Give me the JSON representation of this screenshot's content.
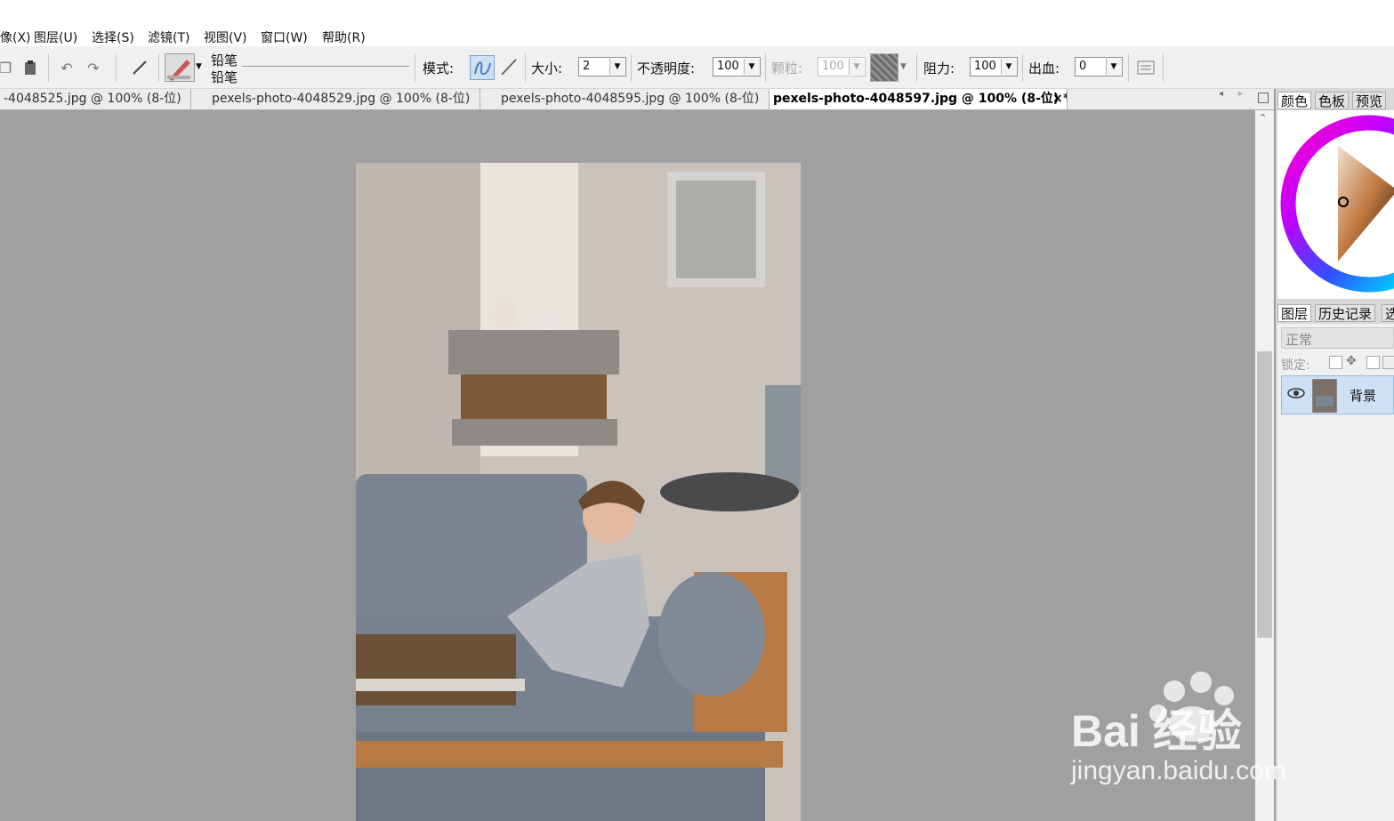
{
  "menu": [
    "像(X)",
    "图层(U)",
    "选择(S)",
    "滤镜(T)",
    "视图(V)",
    "窗口(W)",
    "帮助(R)"
  ],
  "toolbar": {
    "brush_name_top": "铅笔",
    "brush_name_bottom": "铅笔",
    "mode_label": "模式:",
    "size_label": "大小:",
    "size_value": "2",
    "opacity_label": "不透明度:",
    "opacity_value": "100",
    "grain_label": "颗粒:",
    "grain_value": "100",
    "resist_label": "阻力:",
    "resist_value": "100",
    "bleed_label": "出血:",
    "bleed_value": "0"
  },
  "tabs": [
    {
      "label": "-4048525.jpg @ 100% (8-位)"
    },
    {
      "label": "pexels-photo-4048529.jpg @ 100% (8-位)"
    },
    {
      "label": "pexels-photo-4048595.jpg @ 100% (8-位)"
    },
    {
      "label": "pexels-photo-4048597.jpg @ 100% (8-位) *",
      "close": "×"
    }
  ],
  "color_panel": {
    "tabs": [
      "颜色",
      "色板",
      "预览"
    ]
  },
  "layers_panel": {
    "tabs": [
      "图层",
      "历史记录",
      "选"
    ],
    "blend_mode": "正常",
    "lock_label": "锁定:",
    "layers": [
      {
        "name": "背景"
      }
    ]
  },
  "watermark": {
    "brand": "Bai  经验",
    "url": "jingyan.baidu.com"
  },
  "colors": {
    "canvas_bg": "#a0a0a0",
    "sofa": "#7a8490",
    "wood": "#b77a45"
  }
}
